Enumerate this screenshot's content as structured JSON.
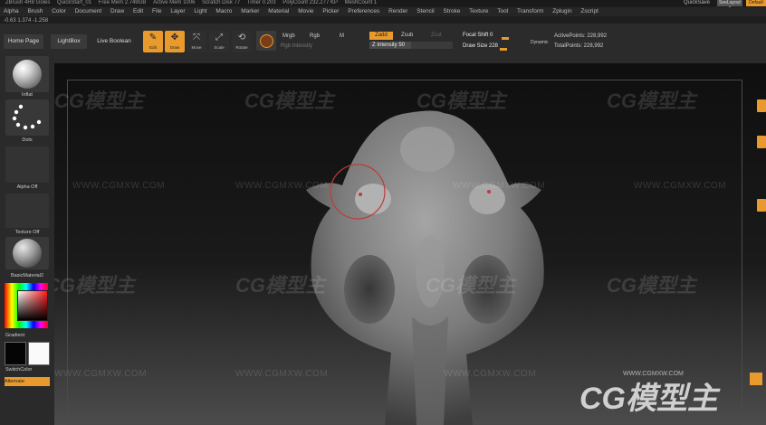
{
  "titlebar": {
    "items": [
      "ZBrush 4R8 Goles",
      "QuickStart_01",
      "Free Mem 2.749GB",
      "Active Mem 1006",
      "Scratch Disk 77",
      "Timer 0.203",
      "PolyCount 232.277 KP",
      "MeshCount 1"
    ],
    "quicksave": "QuickSave",
    "layout_label": "SeeLayout 0",
    "default_label": "Default"
  },
  "menu": [
    "Alpha",
    "Brush",
    "Color",
    "Document",
    "Draw",
    "Edit",
    "File",
    "Layer",
    "Light",
    "Macro",
    "Marker",
    "Material",
    "Movie",
    "Picker",
    "Preferences",
    "Render",
    "Stencil",
    "Stroke",
    "Texture",
    "Tool",
    "Transform",
    "Zplugin",
    "Zscript"
  ],
  "coords": "-0.63 1.374 -1.258",
  "shelf": {
    "home_page": "Home Page",
    "lightbox": "LightBox",
    "live_boolean": "Live Boolean",
    "tools": [
      {
        "name": "Edit",
        "icon": "✎",
        "active": true
      },
      {
        "name": "Draw",
        "icon": "✥",
        "active": true
      },
      {
        "name": "Move",
        "icon": "⤧",
        "active": false
      },
      {
        "name": "Scale",
        "icon": "⤢",
        "active": false
      },
      {
        "name": "Rotate",
        "icon": "⟲",
        "active": false
      }
    ],
    "mrgb": "Mrgb",
    "rgb": "Rgb",
    "m": "M",
    "rgb_intensity": "Rgb Intensity",
    "zadd": "Zadd",
    "zsub": "Zsub",
    "zcut": "Zcut",
    "z_intensity": "Z Intensity 50",
    "focal_shift": "Focal Shift 0",
    "draw_size": "Draw Size 228",
    "dynamic": "Dynamic",
    "active_points": "ActivePoints: 228,992",
    "total_points": "TotalPoints: 228,992"
  },
  "tray": {
    "brush_label": "Inflat",
    "stroke_label": "Dots",
    "alpha_label": "Alpha Off",
    "texture_label": "Texture Off",
    "material_label": "BasicMaterial2",
    "gradient_label": "Gradient",
    "switch_color": "SwitchColor",
    "alternate": "Alternate"
  },
  "watermark": {
    "logo": "CG模型主",
    "url": "WWW.CGMXW.COM"
  },
  "colors": {
    "accent": "#e89a2d",
    "shelf_bg": "#2b2b2b",
    "viewport_bg": "#1a1a1a",
    "brush_circle": "#c0393b"
  }
}
